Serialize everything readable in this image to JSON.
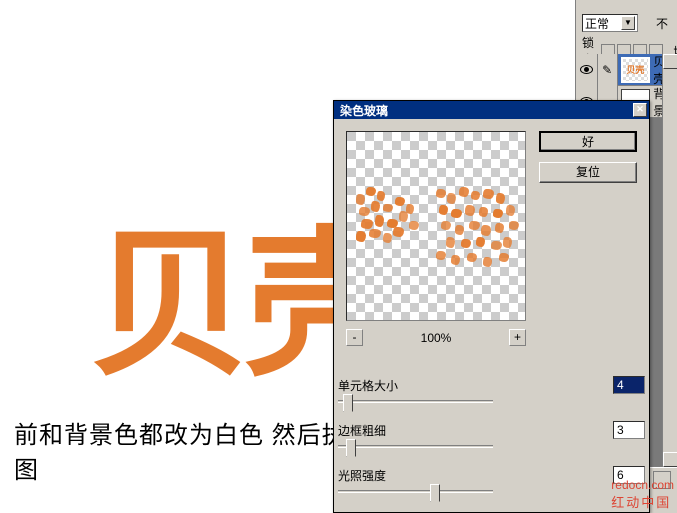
{
  "bg_text": "贝壳",
  "instruction": "前和背景色都改为白色  然后执行滤镜  纹理  染色玻璃  设置如图",
  "dialog": {
    "title": "染色玻璃",
    "ok": "好",
    "reset": "复位",
    "zoom": "100%",
    "cell_size_label": "单元格大小",
    "cell_size_value": "4",
    "border_label": "边框粗细",
    "border_value": "3",
    "light_label": "光照强度",
    "light_value": "6"
  },
  "panel": {
    "blend_mode": "正常",
    "opacity_label": "不",
    "lock_label": "锁定:",
    "fill_suffix": "填",
    "layers": [
      {
        "name": "贝壳",
        "thumb": "贝壳"
      },
      {
        "name": "背景",
        "thumb": ""
      }
    ]
  },
  "watermark": {
    "url": "redocn.com",
    "cn": "红动中国"
  }
}
